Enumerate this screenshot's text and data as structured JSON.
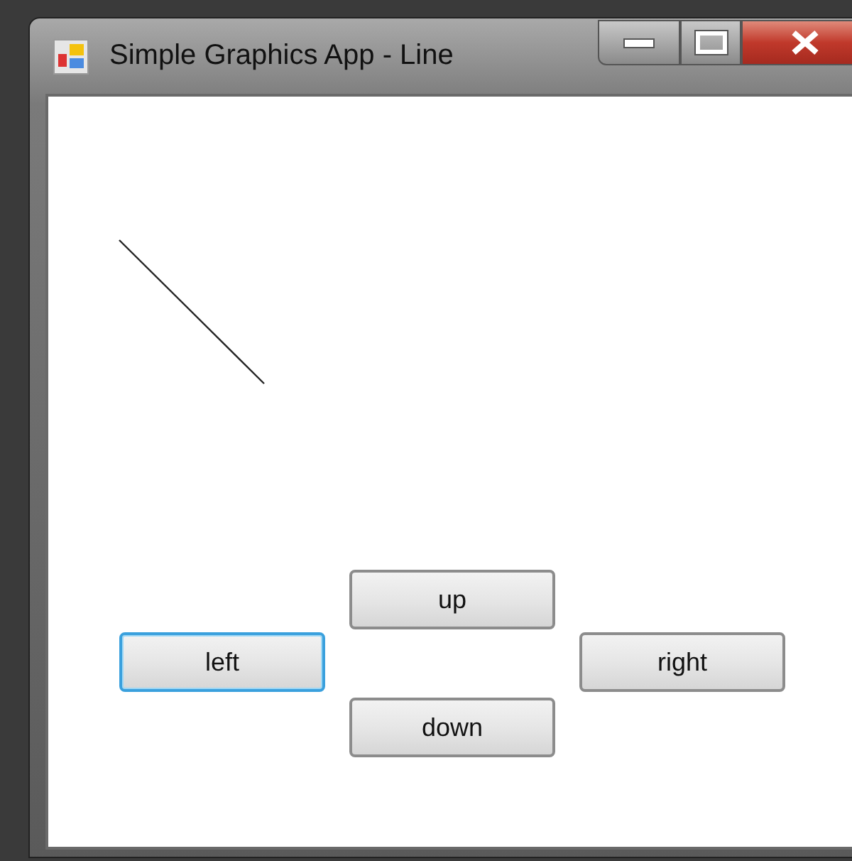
{
  "window": {
    "title": "Simple Graphics App - Line"
  },
  "buttons": [
    {
      "label": "up",
      "focused": false
    },
    {
      "label": "left",
      "focused": true
    },
    {
      "label": "right",
      "focused": false
    },
    {
      "label": "down",
      "focused": false
    }
  ]
}
